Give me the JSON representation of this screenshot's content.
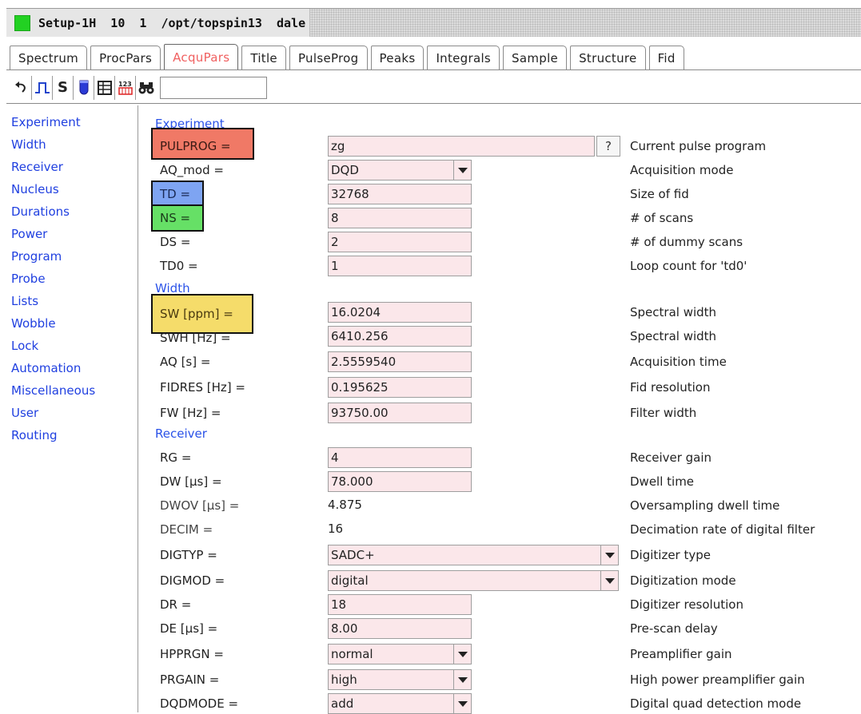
{
  "window": {
    "title": "Setup-1H  10  1  /opt/topspin13  dale",
    "status_color": "#22d122"
  },
  "tabs": [
    {
      "label": "Spectrum"
    },
    {
      "label": "ProcPars"
    },
    {
      "label": "AcquPars",
      "active": true
    },
    {
      "label": "Title"
    },
    {
      "label": "PulseProg"
    },
    {
      "label": "Peaks"
    },
    {
      "label": "Integrals"
    },
    {
      "label": "Sample"
    },
    {
      "label": "Structure"
    },
    {
      "label": "Fid"
    }
  ],
  "toolbar": {
    "icons": [
      "undo-icon",
      "pulse-icon",
      "s-icon",
      "probe-icon",
      "table-icon",
      "numbers-icon",
      "binoculars-icon"
    ],
    "s_label": "S",
    "search_value": ""
  },
  "nav": [
    "Experiment",
    "Width",
    "Receiver",
    "Nucleus",
    "Durations",
    "Power",
    "Program",
    "Probe",
    "Lists",
    "Wobble",
    "Lock",
    "Automation",
    "Miscellaneous",
    "User",
    "Routing"
  ],
  "sections": {
    "experiment": "Experiment",
    "width": "Width",
    "receiver": "Receiver"
  },
  "params": [
    {
      "label": "PULPROG =",
      "value": "zg",
      "desc": "Current pulse program"
    },
    {
      "label": "AQ_mod =",
      "value": "DQD",
      "desc": "Acquisition mode"
    },
    {
      "label": "TD =",
      "value": "32768",
      "desc": "Size of fid"
    },
    {
      "label": "NS =",
      "value": "8",
      "desc": "# of scans"
    },
    {
      "label": "DS =",
      "value": "2",
      "desc": "# of dummy scans"
    },
    {
      "label": "TD0 =",
      "value": "1",
      "desc": "Loop count for 'td0'"
    },
    {
      "label": "SW [ppm] =",
      "value": "16.0204",
      "desc": "Spectral width"
    },
    {
      "label": "SWH [Hz] =",
      "value": "6410.256",
      "desc": "Spectral width"
    },
    {
      "label": "AQ [s] =",
      "value": "2.5559540",
      "desc": "Acquisition time"
    },
    {
      "label": "FIDRES [Hz] =",
      "value": "0.195625",
      "desc": "Fid resolution"
    },
    {
      "label": "FW [Hz] =",
      "value": "93750.00",
      "desc": "Filter width"
    },
    {
      "label": "RG =",
      "value": "4",
      "desc": "Receiver gain"
    },
    {
      "label": "DW [µs] =",
      "value": "78.000",
      "desc": "Dwell time"
    },
    {
      "label": "DWOV [µs] =",
      "value": "4.875",
      "desc": "Oversampling dwell time"
    },
    {
      "label": "DECIM =",
      "value": "16",
      "desc": "Decimation rate of digital filter"
    },
    {
      "label": "DIGTYP =",
      "value": "SADC+",
      "desc": "Digitizer type"
    },
    {
      "label": "DIGMOD =",
      "value": "digital",
      "desc": "Digitization mode"
    },
    {
      "label": "DR =",
      "value": "18",
      "desc": "Digitizer resolution"
    },
    {
      "label": "DE [µs] =",
      "value": "8.00",
      "desc": "Pre-scan delay"
    },
    {
      "label": "HPPRGN =",
      "value": "normal",
      "desc": "Preamplifier gain"
    },
    {
      "label": "PRGAIN =",
      "value": "high",
      "desc": "High power preamplifier gain"
    },
    {
      "label": "DQDMODE =",
      "value": "add",
      "desc": "Digital quad detection mode"
    }
  ],
  "pulprog_help": "?",
  "highlight_colors": {
    "pulprog": "#f07966",
    "td": "#7ea4f2",
    "ns": "#66e066",
    "sw": "#f5dc6a"
  }
}
